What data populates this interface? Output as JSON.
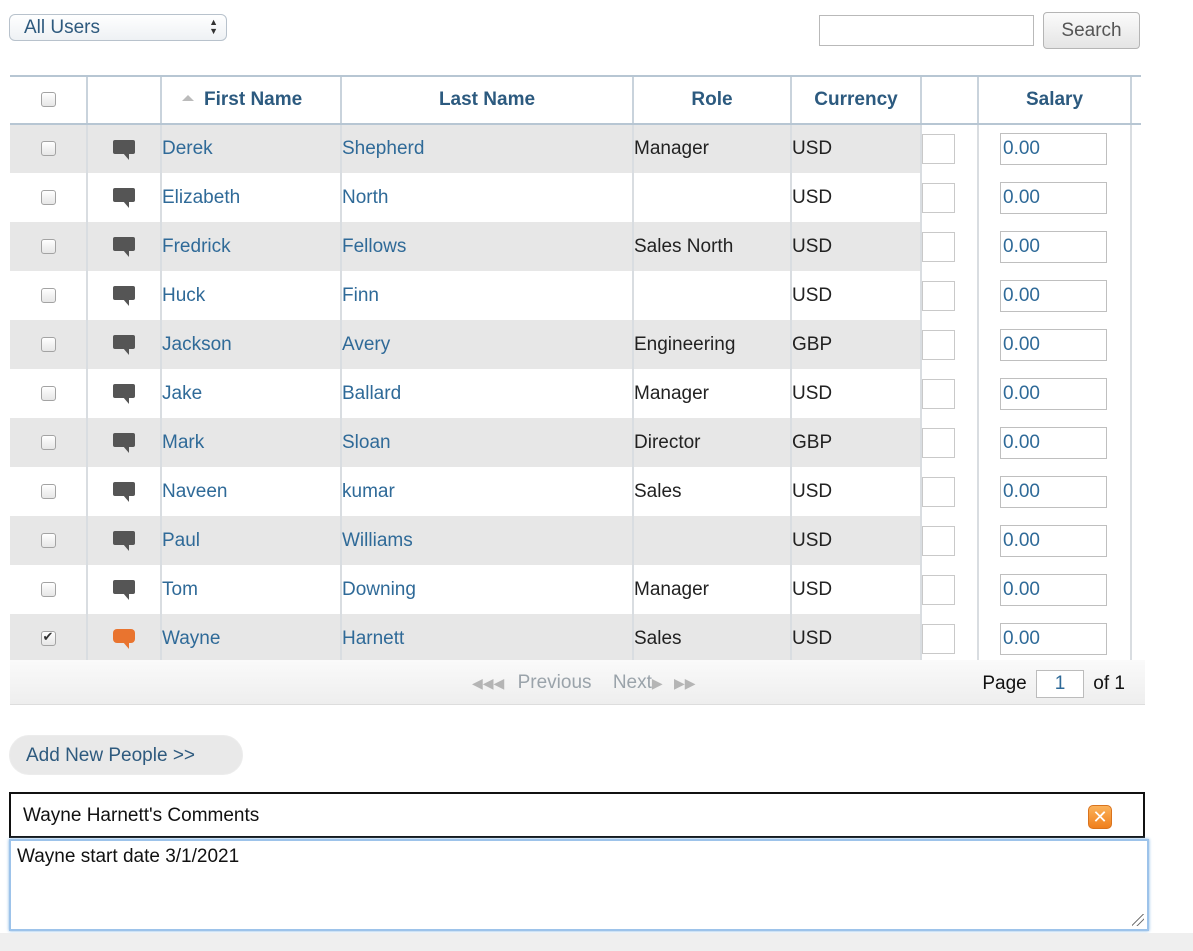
{
  "toolbar": {
    "user_filter": "All Users",
    "search_value": "",
    "search_label": "Search"
  },
  "table": {
    "headers": {
      "first_name": "First Name",
      "last_name": "Last Name",
      "role": "Role",
      "currency": "Currency",
      "salary": "Salary"
    },
    "rows": [
      {
        "checked": false,
        "comment_active": false,
        "first": "Derek",
        "last": "Shepherd",
        "role": "Manager",
        "currency": "USD",
        "salary": "0.00"
      },
      {
        "checked": false,
        "comment_active": false,
        "first": "Elizabeth",
        "last": "North",
        "role": "",
        "currency": "USD",
        "salary": "0.00"
      },
      {
        "checked": false,
        "comment_active": false,
        "first": "Fredrick",
        "last": "Fellows",
        "role": "Sales North",
        "currency": "USD",
        "salary": "0.00"
      },
      {
        "checked": false,
        "comment_active": false,
        "first": "Huck",
        "last": "Finn",
        "role": "",
        "currency": "USD",
        "salary": "0.00"
      },
      {
        "checked": false,
        "comment_active": false,
        "first": "Jackson",
        "last": "Avery",
        "role": "Engineering",
        "currency": "GBP",
        "salary": "0.00"
      },
      {
        "checked": false,
        "comment_active": false,
        "first": "Jake",
        "last": "Ballard",
        "role": "Manager",
        "currency": "USD",
        "salary": "0.00"
      },
      {
        "checked": false,
        "comment_active": false,
        "first": "Mark",
        "last": "Sloan",
        "role": "Director",
        "currency": "GBP",
        "salary": "0.00"
      },
      {
        "checked": false,
        "comment_active": false,
        "first": "Naveen",
        "last": "kumar",
        "role": "Sales",
        "currency": "USD",
        "salary": "0.00"
      },
      {
        "checked": false,
        "comment_active": false,
        "first": "Paul",
        "last": "Williams",
        "role": "",
        "currency": "USD",
        "salary": "0.00"
      },
      {
        "checked": false,
        "comment_active": false,
        "first": "Tom",
        "last": "Downing",
        "role": "Manager",
        "currency": "USD",
        "salary": "0.00"
      },
      {
        "checked": true,
        "comment_active": true,
        "first": "Wayne",
        "last": "Harnett",
        "role": "Sales",
        "currency": "USD",
        "salary": "0.00"
      }
    ]
  },
  "pager": {
    "previous": "Previous",
    "next": "Next",
    "page_label": "Page",
    "page": "1",
    "of_label": "of 1"
  },
  "add_people": "Add New People >>",
  "comments": {
    "title": "Wayne Harnett's Comments",
    "text": "Wayne start date 3/1/2021"
  },
  "colors": {
    "link": "#2f6a98",
    "accent_orange": "#e9742f",
    "row_shade": "#e7e7e7"
  }
}
